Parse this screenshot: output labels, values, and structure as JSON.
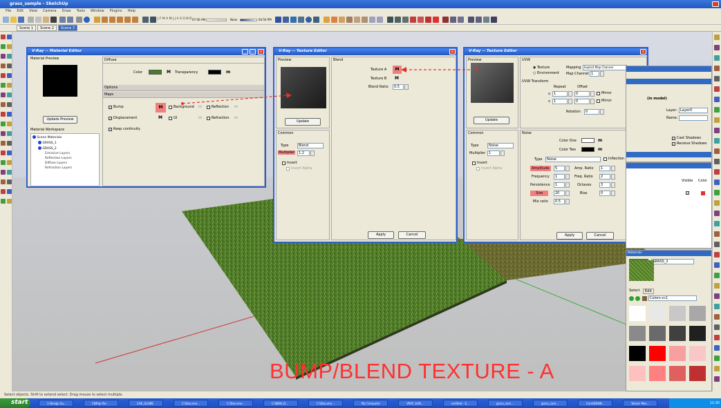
{
  "app": {
    "title": "grass_sample - SketchUp"
  },
  "menu": [
    "File",
    "Edit",
    "View",
    "Camera",
    "Draw",
    "Tools",
    "Window",
    "Plugins",
    "Help"
  ],
  "toolbar": {
    "time_left": "07:00 AM",
    "time_mid": "Noon",
    "time_right": "04:54 PM",
    "months": "J F M A M J J A S O N D"
  },
  "scenes": {
    "tabs": [
      "Scene 1",
      "Scene 2",
      "Scene 3"
    ],
    "active": 2
  },
  "mat_editor": {
    "title": "V-Ray -- Material Editor",
    "preview_label": "Material Preview",
    "update_btn": "Update Preview",
    "workspace_label": "Material Workspace",
    "tree": [
      "Scene Materials",
      "GRASS_1",
      "GRASS_2",
      "Emissive Layers",
      "Reflection Layers",
      "Diffuse Layers",
      "Refraction Layers"
    ],
    "diffuse": "Diffuse",
    "color_label": "Color",
    "transparency_label": "Transparency",
    "options": "Options",
    "maps": "Maps",
    "bump": "Bump",
    "background": "Background",
    "reflection": "Reflection",
    "displacement": "Displacement",
    "gi": "GI",
    "refraction": "Refraction",
    "keep_continuity": "Keep continuity",
    "m": "M",
    "m_small": "m"
  },
  "tex_editor1": {
    "title": "V-Ray -- Texture Editor",
    "preview": "Preview",
    "blend": "Blend",
    "texture_a": "Texture A",
    "texture_b": "Texture B",
    "blend_ratio": "Blend Ratio",
    "blend_ratio_val": "0.5",
    "update": "Update",
    "common": "Common",
    "type_label": "Type",
    "type_val": "Blend",
    "multiplier_label": "Multiplier",
    "multiplier_val": "1.2",
    "invert": "Invert",
    "invert_alpha": "Invert Alpha",
    "apply": "Apply",
    "cancel": "Cancel"
  },
  "tex_editor2": {
    "title": "V-Ray -- Texture Editor",
    "preview": "Preview",
    "uvw": "UVW",
    "texture": "Texture",
    "environment": "Environment",
    "mapping_label": "Mapping",
    "mapping_val": "Explicit Map Channel",
    "map_channel_label": "Map Channel",
    "map_channel_val": "1",
    "uvw_transform": "UVW Transform",
    "repeat": "Repeat",
    "offset": "Offset",
    "u": "u",
    "v": "v",
    "u_repeat": "1",
    "u_offset": "0",
    "v_repeat": "1",
    "v_offset": "0",
    "mirror": "Mirror",
    "rotation": "Rotation",
    "rotation_val": "0",
    "update": "Update",
    "common": "Common",
    "type_label": "Type",
    "type_val": "Noise",
    "multiplier_label": "Multiplier",
    "multiplier_val": "1",
    "invert": "Invert",
    "invert_alpha": "Invert Alpha",
    "noise": "Noise",
    "color_one": "Color One",
    "color_two": "Color Two",
    "noise_type_label": "Type",
    "noise_type_val": "Noise",
    "inflection": "Inflection",
    "amplitude": "Amplitude",
    "amplitude_val": "5",
    "amp_ratio": "Amp. Ratio",
    "amp_ratio_val": "1",
    "frequency": "Frequency",
    "frequency_val": "1",
    "freq_ratio": "Freq. Ratio",
    "freq_ratio_val": "2",
    "persistence": "Persistence",
    "persistence_val": "1",
    "octaves": "Octaves",
    "octaves_val": "3",
    "size": "Size",
    "size_val": "20",
    "bias": "Bias",
    "bias_val": "0",
    "mix_ratio": "Mix ratio",
    "mix_ratio_val": "0.5",
    "apply": "Apply",
    "cancel": "Cancel",
    "m": "m"
  },
  "right_panel": {
    "entity": "(in model)",
    "layer_label": "Layer:",
    "layer_val": "Layer0",
    "name_label": "Name:",
    "cast_shadows": "Cast Shadows",
    "receive_shadows": "Receive Shadows",
    "visible": "Visible",
    "color": "Color",
    "materials_title": "Materials",
    "material_name": "GRASS_2",
    "select": "Select",
    "edit": "Edit",
    "colors_dropdown": "Colors-cc1"
  },
  "palette": [
    "#ffffff",
    "#e8e8e8",
    "#c8c8c8",
    "#a8a8a8",
    "#8a8a8a",
    "#6a6a6a",
    "#404040",
    "#202020",
    "#000000",
    "#ff0000",
    "#f8a0a0",
    "#f8c8c8",
    "#ffc0c0",
    "#ff8080",
    "#e06060",
    "#c03030"
  ],
  "overlay": {
    "caption": "BUMP/BLEND TEXTURE - A"
  },
  "status": "Select objects. Shift to extend select. Drag mouse to select multiple.",
  "taskbar": {
    "start": "start",
    "buttons": [
      "3 Design Su...",
      "CNRdp-Ter...",
      "CHE_GLOBE",
      "C:\\Docume...",
      "C:\\Docume...",
      "C:\\NEW_D...",
      "C:\\Docume...",
      "My Computer",
      "VRAY_SUN...",
      "untitled - S...",
      "grass_sam...",
      "grass_sam...",
      "CorelDRAW...",
      "Yahoo! Mes..."
    ],
    "clock": "12:30"
  },
  "colors": {
    "accent": "#2458c4",
    "red_btn": "#f08080",
    "grass": "#4a7a2a"
  }
}
